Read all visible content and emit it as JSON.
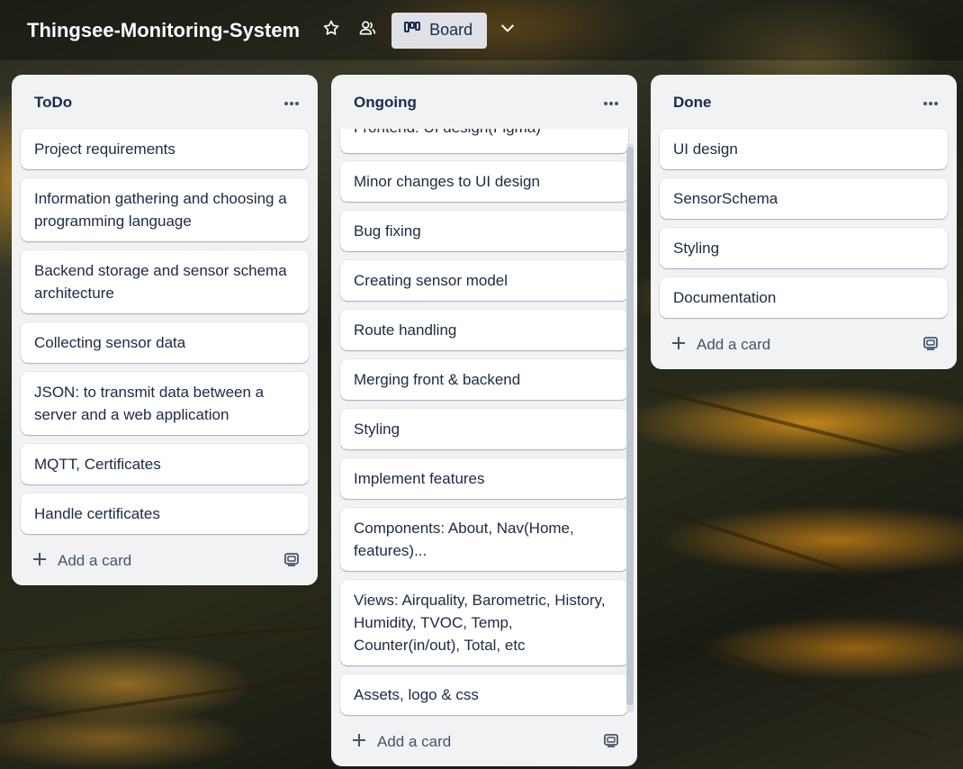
{
  "board": {
    "title": "Thingsee-Monitoring-System",
    "view_label": "Board"
  },
  "lists": [
    {
      "title": "ToDo",
      "cards": [
        "Project requirements",
        "Information gathering and choosing a programming language",
        "Backend storage and sensor schema architecture",
        "Collecting sensor data",
        "JSON: to transmit data between a server and a web application",
        "MQTT, Certificates",
        "Handle certificates"
      ],
      "add_label": "Add a card"
    },
    {
      "title": "Ongoing",
      "cards": [
        "Frontend: UI design(Figma)",
        "Minor changes to UI design",
        "Bug fixing",
        "Creating sensor model",
        "Route handling",
        "Merging front & backend",
        "Styling",
        "Implement features",
        "Components: About, Nav(Home, features)...",
        "Views: Airquality, Barometric, History, Humidity, TVOC, Temp, Counter(in/out), Total, etc",
        "Assets, logo & css"
      ],
      "add_label": "Add a card"
    },
    {
      "title": "Done",
      "cards": [
        "UI design",
        "SensorSchema",
        "Styling",
        "Documentation"
      ],
      "add_label": "Add a card"
    }
  ],
  "icons": {
    "star": "star-icon",
    "members": "members-icon",
    "board_view": "board-view-icon",
    "chevron": "chevron-down-icon",
    "more": "more-icon",
    "plus": "plus-icon",
    "template": "template-icon"
  }
}
